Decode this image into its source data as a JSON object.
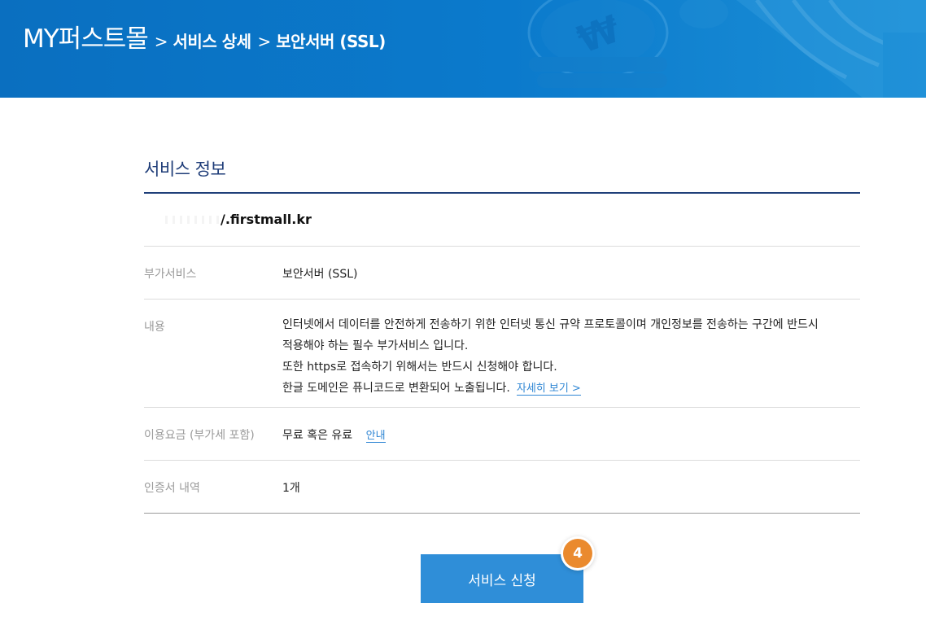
{
  "header": {
    "home": "MY퍼스트몰",
    "separator": ">",
    "crumbs": [
      "서비스 상세",
      "보안서버 (SSL)"
    ],
    "bg_color": "#0b75c6"
  },
  "section": {
    "title": "서비스 정보",
    "domain": "/.firstmall.kr"
  },
  "rows": {
    "addon": {
      "label": "부가서비스",
      "value": "보안서버 (SSL)"
    },
    "content": {
      "label": "내용",
      "lines": [
        "인터넷에서 데이터를 안전하게 전송하기 위한 인터넷 통신 규약 프로토콜이며 개인정보를 전송하는 구간에 반드시",
        "적용해야 하는 필수 부가서비스 입니다.",
        "또한 https로 접속하기 위해서는 반드시 신청해야 합니다.",
        "한글 도메인은 퓨니코드로 변환되어 노출됩니다."
      ],
      "link": "자세히 보기 >"
    },
    "fee": {
      "label": "이용요금 (부가세 포함)",
      "value": "무료 혹은 유료",
      "link": "안내"
    },
    "certs": {
      "label": "인증서 내역",
      "value": "1개"
    }
  },
  "action": {
    "button_label": "서비스 신청",
    "badge": "4",
    "button_color": "#2f8ed8",
    "badge_color": "#ea8a2e"
  }
}
